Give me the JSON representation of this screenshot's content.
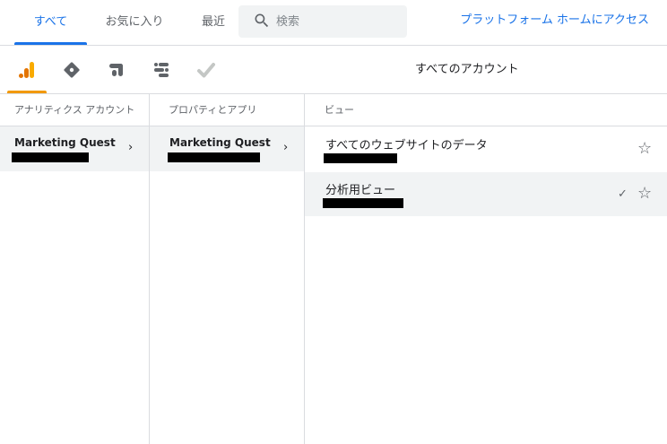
{
  "tabs": {
    "all": "すべて",
    "favorites": "お気に入り",
    "recent": "最近"
  },
  "search": {
    "placeholder": "検索"
  },
  "platform_link": "プラットフォーム ホームにアクセス",
  "products": [
    {
      "name": "analytics-icon",
      "color": "#f29900"
    },
    {
      "name": "tag-manager-icon",
      "color": "#5f6368"
    },
    {
      "name": "optimize-icon",
      "color": "#5f6368"
    },
    {
      "name": "data-studio-icon",
      "color": "#5f6368"
    },
    {
      "name": "surveys-icon",
      "color": "#bdbdbd"
    }
  ],
  "all_accounts_label": "すべてのアカウント",
  "columns": {
    "accounts": {
      "header": "アナリティクス アカウント",
      "items": [
        {
          "title": "Marketing Quest"
        }
      ]
    },
    "properties": {
      "header": "プロパティとアプリ",
      "items": [
        {
          "title": "Marketing Quest"
        }
      ]
    },
    "views": {
      "header": "ビュー",
      "items": [
        {
          "title": "すべてのウェブサイトのデータ"
        },
        {
          "title": "分析用ビュー",
          "checked": true
        }
      ]
    }
  },
  "glyphs": {
    "chevron": "›",
    "star": "☆",
    "check": "✓"
  }
}
